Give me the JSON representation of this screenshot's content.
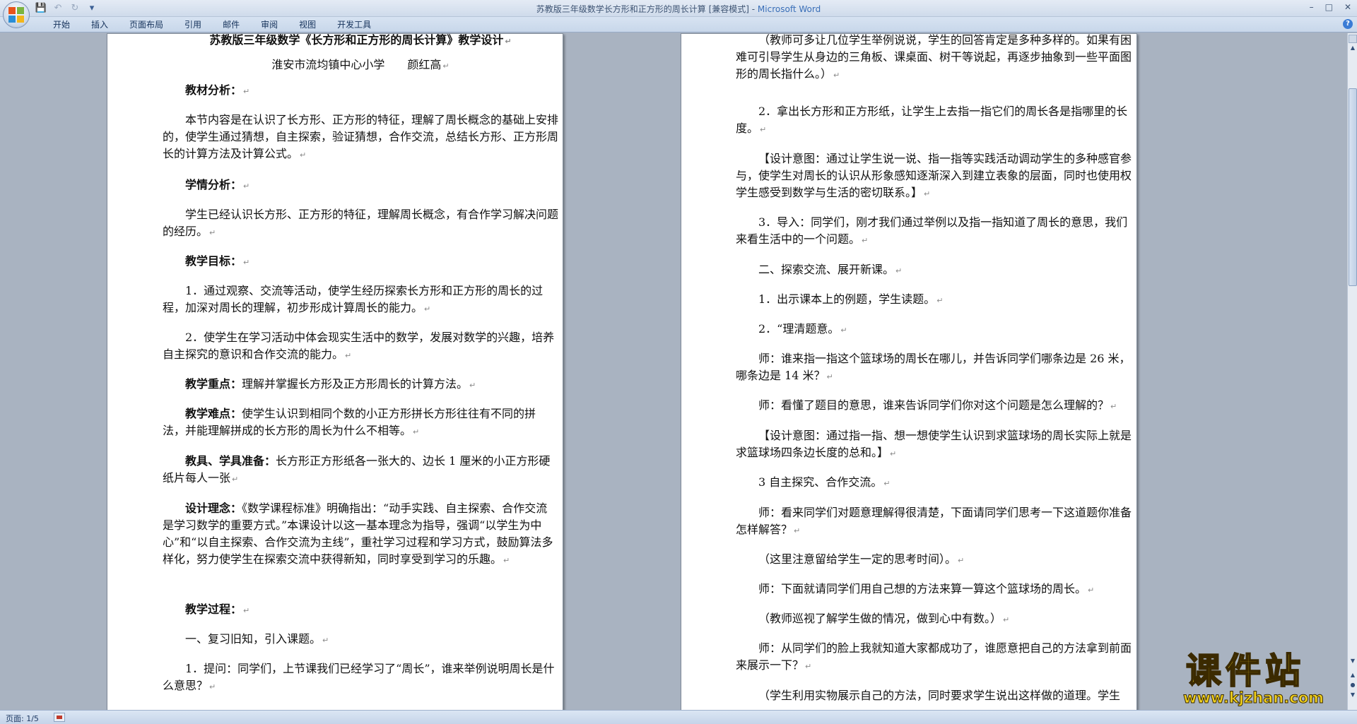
{
  "window": {
    "title": "苏教版三年级数学长方形和正方形的周长计算 [兼容模式] - ",
    "app_name": "Microsoft Word",
    "controls": [
      "–",
      "□",
      "✕"
    ]
  },
  "qat": {
    "save_icon": "save-icon",
    "undo_icon": "undo-icon",
    "redo_icon": "redo-icon",
    "customize": "▾"
  },
  "ribbon_tabs": [
    "开始",
    "插入",
    "页面布局",
    "引用",
    "邮件",
    "审阅",
    "视图",
    "开发工具"
  ],
  "page1": {
    "title": "苏教版三年级数学《长方形和正方形的周长计算》教学设计",
    "author": "淮安市流均镇中心小学　　颜红高",
    "h_analysis": "教材分析：",
    "analysis": "本节内容是在认识了长方形、正方形的特征，理解了周长概念的基础上安排的，使学生通过猜想，自主探索，验证猜想，合作交流，总结长方形、正方形周长的计算方法及计算公式。",
    "h_students": "学情分析：",
    "students": "学生已经认识长方形、正方形的特征，理解周长概念，有合作学习解决问题的经历。",
    "h_goals": "教学目标：",
    "goal1": "1．通过观察、交流等活动，使学生经历探索长方形和正方形的周长的过程，加深对周长的理解，初步形成计算周长的能力。",
    "goal2": "2．使学生在学习活动中体会现实生活中的数学，发展对数学的兴趣，培养自主探究的意识和合作交流的能力。",
    "h_key": "教学重点：",
    "key": "理解并掌握长方形及正方形周长的计算方法。",
    "h_difficult": "教学难点：",
    "difficult": "使学生认识到相同个数的小正方形拼长方形往往有不同的拼法，并能理解拼成的长方形的周长为什么不相等。",
    "h_tools": "教具、学具准备：",
    "tools": "长方形正方形纸各一张大的、边长 1 厘米的小正方形硬纸片每人一张",
    "h_idea": "设计理念：",
    "idea": "《数学课程标准》明确指出：“动手实践、自主探索、合作交流是学习数学的重要方式。”本课设计以这一基本理念为指导，强调“以学生为中心”和“以自主探索、合作交流为主线”，重社学习过程和学习方式，鼓励算法多样化，努力使学生在探索交流中获得新知，同时享受到学习的乐趣。",
    "h_process": "教学过程：",
    "review": "一、复习旧知，引入课题。",
    "q1": "1．提问：同学们，上节课我们已经学习了“周长”，谁来举例说明周长是什么意思？"
  },
  "page2": {
    "l1": "（教师可多让几位学生举例说说，学生的回答肯定是多种多样的。如果有困难可引导学生从身边的三角板、课桌面、树干等说起，再逐步抽象到一些平面图形的周长指什么。）",
    "l2": "2．拿出长方形和正方形纸，让学生上去指一指它们的周长各是指哪里的长度。",
    "l3": "【设计意图：通过让学生说一说、指一指等实践活动调动学生的多种感官参与，使学生对周长的认识从形象感知逐渐深入到建立表象的层面，同时也使用权学生感受到数学与生活的密切联系。】",
    "l4": "3．导入：同学们，刚才我们通过举例以及指一指知道了周长的意思，我们来看生活中的一个问题。",
    "l5": "二、探索交流、展开新课。",
    "l6": "1．出示课本上的例题，学生读题。",
    "l7": "2．“理清题意。",
    "l8": "师：谁来指一指这个篮球场的周长在哪儿，并告诉同学们哪条边是 26 米，哪条边是 14 米？",
    "l9": "师：看懂了题目的意思，谁来告诉同学们你对这个问题是怎么理解的？",
    "l10": "【设计意图：通过指一指、想一想使学生认识到求篮球场的周长实际上就是求篮球场四条边长度的总和。】",
    "l11": "3 自主探究、合作交流。",
    "l12": "师：看来同学们对题意理解得很清楚，下面请同学们思考一下这道题你准备怎样解答？",
    "l13": "（这里注意留给学生一定的思考时间）。",
    "l14": "师：下面就请同学们用自己想的方法来算一算这个篮球场的周长。",
    "l15": "（教师巡视了解学生做的情况，做到心中有数。）",
    "l16": "师：从同学们的脸上我就知道大家都成功了，谁愿意把自己的方法拿到前面来展示一下？",
    "l17": "（学生利用实物展示自己的方法，同时要求学生说出这样做的道理。学生"
  },
  "paragraph_mark": "↵",
  "status": {
    "page": "页面: 1/5"
  },
  "watermark": {
    "title": "课件站",
    "url": "www.kjzhan.com"
  }
}
